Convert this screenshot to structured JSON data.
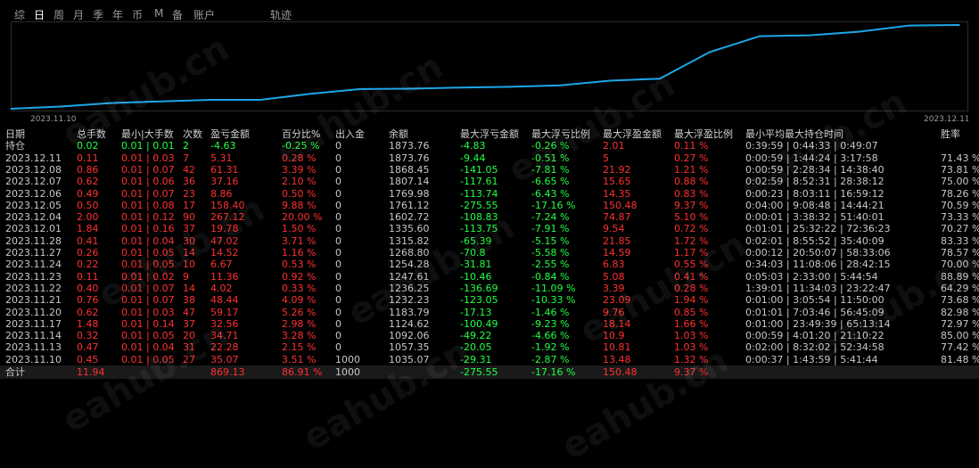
{
  "tabs": [
    "综",
    "日",
    "周",
    "月",
    "季",
    "年",
    "币",
    "M",
    "备",
    "账户",
    "轨迹"
  ],
  "active_tab": 1,
  "chart_data": {
    "type": "line",
    "x": [
      "2023.11.10",
      "2023.11.13",
      "2023.11.14",
      "2023.11.15",
      "2023.11.16",
      "2023.11.17",
      "2023.11.20",
      "2023.11.21",
      "2023.11.22",
      "2023.11.23",
      "2023.11.24",
      "2023.11.27",
      "2023.11.28",
      "2023.12.01",
      "2023.12.04",
      "2023.12.05",
      "2023.12.06",
      "2023.12.07",
      "2023.12.08",
      "2023.12.11"
    ],
    "values": [
      1035.07,
      1057.35,
      1092.06,
      1108,
      1124.62,
      1124.62,
      1183.79,
      1232.23,
      1236.25,
      1247.61,
      1254.28,
      1268.8,
      1315.82,
      1335.6,
      1602.72,
      1761.12,
      1769.98,
      1807.14,
      1868.45,
      1873.76
    ],
    "xlabel_start": "2023.11.10",
    "xlabel_end": "2023.12.11",
    "line_color": "#1ea6e8"
  },
  "table": {
    "headers": [
      "日期",
      "总手数",
      "最小|大手数",
      "次数",
      "盈亏金额",
      "百分比%",
      "出入金",
      "余额",
      "最大浮亏金额",
      "最大浮亏比例",
      "最大浮盈金额",
      "最大浮盈比例",
      "最小平均最大持仓时间",
      "胜率"
    ],
    "holding": [
      "持仓",
      "0.02",
      "0.01 | 0.01",
      "2",
      "-4.63",
      "-0.25 %",
      "0",
      "1873.76",
      "-4.83",
      "-0.26 %",
      "2.01",
      "0.11 %",
      "0:39:59 | 0:44:33 | 0:49:07",
      ""
    ],
    "rows": [
      [
        "2023.12.11",
        "0.11",
        "0.01 | 0.03",
        "7",
        "5.31",
        "0.28 %",
        "0",
        "1873.76",
        "-9.44",
        "-0.51 %",
        "5",
        "0.27 %",
        "0:00:59 | 1:44:24 | 3:17:58",
        "71.43 %"
      ],
      [
        "2023.12.08",
        "0.86",
        "0.01 | 0.07",
        "42",
        "61.31",
        "3.39 %",
        "0",
        "1868.45",
        "-141.05",
        "-7.81 %",
        "21.92",
        "1.21 %",
        "0:00:59 | 2:28:34 | 14:38:40",
        "73.81 %"
      ],
      [
        "2023.12.07",
        "0.62",
        "0.01 | 0.06",
        "36",
        "37.16",
        "2.10 %",
        "0",
        "1807.14",
        "-117.61",
        "-6.65 %",
        "15.65",
        "0.88 %",
        "0:02:59 | 8:52:31 | 28:38:12",
        "75.00 %"
      ],
      [
        "2023.12.06",
        "0.49",
        "0.01 | 0.07",
        "23",
        "8.86",
        "0.50 %",
        "0",
        "1769.98",
        "-113.74",
        "-6.43 %",
        "14.35",
        "0.83 %",
        "0:00:23 | 8:03:11 | 16:59:12",
        "78.26 %"
      ],
      [
        "2023.12.05",
        "0.50",
        "0.01 | 0.08",
        "17",
        "158.40",
        "9.88 %",
        "0",
        "1761.12",
        "-275.55",
        "-17.16 %",
        "150.48",
        "9.37 %",
        "0:04:00 | 9:08:48 | 14:44:21",
        "70.59 %"
      ],
      [
        "2023.12.04",
        "2.00",
        "0.01 | 0.12",
        "90",
        "267.12",
        "20.00 %",
        "0",
        "1602.72",
        "-108.83",
        "-7.24 %",
        "74.87",
        "5.10 %",
        "0:00:01 | 3:38:32 | 51:40:01",
        "73.33 %"
      ],
      [
        "2023.12.01",
        "1.84",
        "0.01 | 0.16",
        "37",
        "19.78",
        "1.50 %",
        "0",
        "1335.60",
        "-113.75",
        "-7.91 %",
        "9.54",
        "0.72 %",
        "0:01:01 | 25:32:22 | 72:36:23",
        "70.27 %"
      ],
      [
        "2023.11.28",
        "0.41",
        "0.01 | 0.04",
        "30",
        "47.02",
        "3.71 %",
        "0",
        "1315.82",
        "-65.39",
        "-5.15 %",
        "21.85",
        "1.72 %",
        "0:02:01 | 8:55:52 | 35:40:09",
        "83.33 %"
      ],
      [
        "2023.11.27",
        "0.26",
        "0.01 | 0.05",
        "14",
        "14.52",
        "1.16 %",
        "0",
        "1268.80",
        "-70.8",
        "-5.58 %",
        "14.59",
        "1.17 %",
        "0:00:12 | 20:50:07 | 58:33:06",
        "78.57 %"
      ],
      [
        "2023.11.24",
        "0.22",
        "0.01 | 0.05",
        "10",
        "6.67",
        "0.53 %",
        "0",
        "1254.28",
        "-31.81",
        "-2.55 %",
        "6.83",
        "0.55 %",
        "0:34:03 | 11:08:06 | 28:42:15",
        "70.00 %"
      ],
      [
        "2023.11.23",
        "0.11",
        "0.01 | 0.02",
        "9",
        "11.36",
        "0.92 %",
        "0",
        "1247.61",
        "-10.46",
        "-0.84 %",
        "5.08",
        "0.41 %",
        "0:05:03 | 2:33:00 | 5:44:54",
        "88.89 %"
      ],
      [
        "2023.11.22",
        "0.40",
        "0.01 | 0.07",
        "14",
        "4.02",
        "0.33 %",
        "0",
        "1236.25",
        "-136.69",
        "-11.09 %",
        "3.39",
        "0.28 %",
        "1:39:01 | 11:34:03 | 23:22:47",
        "64.29 %"
      ],
      [
        "2023.11.21",
        "0.76",
        "0.01 | 0.07",
        "38",
        "48.44",
        "4.09 %",
        "0",
        "1232.23",
        "-123.05",
        "-10.33 %",
        "23.09",
        "1.94 %",
        "0:01:00 | 3:05:54 | 11:50:00",
        "73.68 %"
      ],
      [
        "2023.11.20",
        "0.62",
        "0.01 | 0.03",
        "47",
        "59.17",
        "5.26 %",
        "0",
        "1183.79",
        "-17.13",
        "-1.46 %",
        "9.76",
        "0.85 %",
        "0:01:01 | 7:03:46 | 56:45:09",
        "82.98 %"
      ],
      [
        "2023.11.17",
        "1.48",
        "0.01 | 0.14",
        "37",
        "32.56",
        "2.98 %",
        "0",
        "1124.62",
        "-100.49",
        "-9.23 %",
        "18.14",
        "1.66 %",
        "0:01:00 | 23:49:39 | 65:13:14",
        "72.97 %"
      ],
      [
        "2023.11.14",
        "0.32",
        "0.01 | 0.05",
        "20",
        "34.71",
        "3.28 %",
        "0",
        "1092.06",
        "-49.22",
        "-4.66 %",
        "10.9",
        "1.03 %",
        "0:00:59 | 4:01:20 | 21:10:22",
        "85.00 %"
      ],
      [
        "2023.11.13",
        "0.47",
        "0.01 | 0.04",
        "31",
        "22.28",
        "2.15 %",
        "0",
        "1057.35",
        "-20.05",
        "-1.92 %",
        "10.81",
        "1.03 %",
        "0:02:00 | 8:32:02 | 52:34:58",
        "77.42 %"
      ],
      [
        "2023.11.10",
        "0.45",
        "0.01 | 0.05",
        "27",
        "35.07",
        "3.51 %",
        "1000",
        "1035.07",
        "-29.31",
        "-2.87 %",
        "13.48",
        "1.32 %",
        "0:00:37 | 1:43:59 | 5:41:44",
        "81.48 %"
      ]
    ],
    "total": [
      "合计",
      "11.94",
      "",
      "",
      "869.13",
      "86.91 %",
      "1000",
      "",
      "-275.55",
      "-17.16 %",
      "150.48",
      "9.37 %",
      "",
      ""
    ]
  },
  "colors": {
    "positive": "#ff3030",
    "negative": "#22ff44",
    "neutral": "#c8c8c8",
    "line": "#1ea6e8"
  },
  "watermark_text": "eahub.cn"
}
